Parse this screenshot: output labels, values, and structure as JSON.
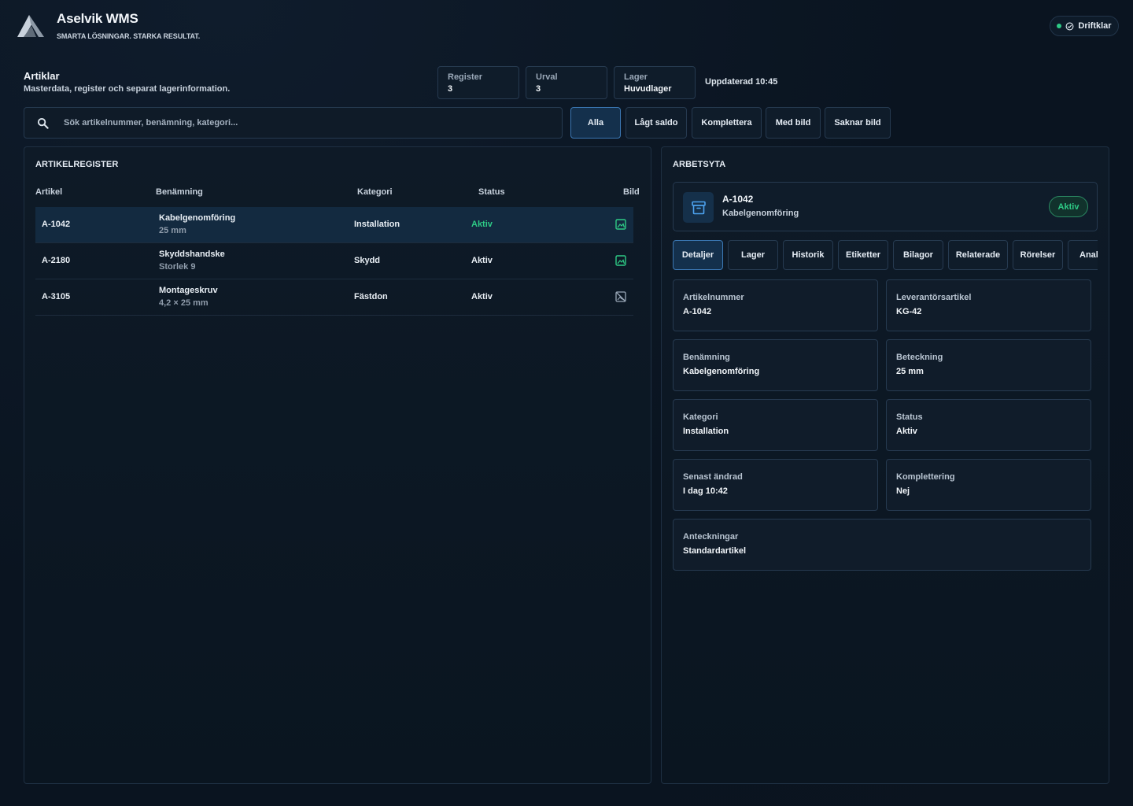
{
  "header": {
    "brand": "Aselvik WMS",
    "tagline": "SMARTA LÖSNINGAR. STARKA RESULTAT.",
    "status_pill": "Driftklar",
    "status_color": "#2ecb86"
  },
  "page": {
    "title": "Artiklar",
    "subtitle": "Masterdata, register och separat lagerinformation."
  },
  "stats": [
    {
      "label": "Register",
      "value": "3"
    },
    {
      "label": "Urval",
      "value": "3"
    },
    {
      "label": "Lager",
      "value": "Huvudlager"
    }
  ],
  "updated": "Uppdaterad 10:45",
  "search": {
    "placeholder": "Sök artikelnummer, benämning, kategori...",
    "icon": "search-icon"
  },
  "filters": [
    "Alla",
    "Lågt saldo",
    "Komplettera",
    "Med bild",
    "Saknar bild"
  ],
  "active_filter": "Alla",
  "register": {
    "title": "ARTIKELREGISTER",
    "columns": [
      "Artikel",
      "Benämning",
      "Kategori",
      "Status",
      "Bild"
    ],
    "rows": [
      {
        "article": "A-1042",
        "name": "Kabelgenomföring",
        "detail": "25 mm",
        "category": "Installation",
        "status": "Aktiv",
        "image": "image-icon",
        "selected": true
      },
      {
        "article": "A-2180",
        "name": "Skyddshandske",
        "detail": "Storlek 9",
        "category": "Skydd",
        "status": "Aktiv",
        "image": "image-icon",
        "selected": false
      },
      {
        "article": "A-3105",
        "name": "Montageskruv",
        "detail": "4,2 × 25 mm",
        "category": "Fästdon",
        "status": "Aktiv",
        "image": "no-image-icon",
        "selected": false
      }
    ]
  },
  "workspace": {
    "title": "ARBETSYTA",
    "item": {
      "code": "A-1042",
      "name": "Kabelgenomföring",
      "badge": "Aktiv",
      "icon": "archive-icon"
    },
    "tabs": [
      "Detaljer",
      "Lager",
      "Historik",
      "Etiketter",
      "Bilagor",
      "Relaterade",
      "Rörelser",
      "Anal"
    ],
    "active_tab": "Detaljer",
    "fields": [
      {
        "label": "Artikelnummer",
        "value": "A-1042"
      },
      {
        "label": "Leverantörsartikel",
        "value": "KG-42"
      },
      {
        "label": "Benämning",
        "value": "Kabelgenomföring"
      },
      {
        "label": "Beteckning",
        "value": "25 mm"
      },
      {
        "label": "Kategori",
        "value": "Installation"
      },
      {
        "label": "Status",
        "value": "Aktiv"
      },
      {
        "label": "Senast ändrad",
        "value": "I dag 10:42"
      },
      {
        "label": "Komplettering",
        "value": "Nej"
      },
      {
        "label": "Anteckningar",
        "value": "Standardartikel"
      }
    ]
  },
  "colors": {
    "accent": "#3b77b3",
    "success": "#2ecb86",
    "background": "#0a1420"
  }
}
